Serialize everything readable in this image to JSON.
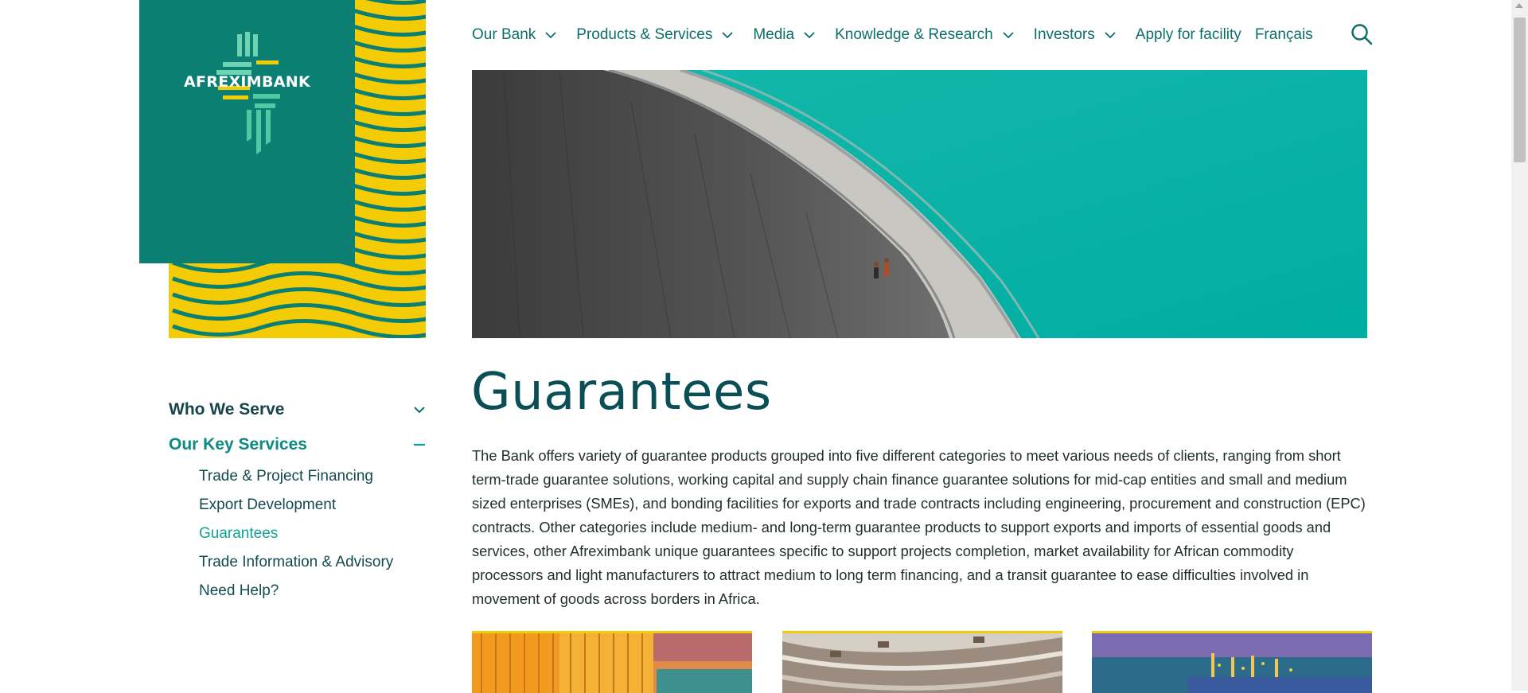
{
  "brand": {
    "logo_text": "AFREXIMBANK",
    "colors": {
      "teal": "#0c7f73",
      "yellow": "#f3cc06",
      "nav_text": "#0c6e68",
      "accent": "#0ea393"
    }
  },
  "nav": {
    "items": [
      {
        "label": "Our Bank",
        "has_dropdown": true
      },
      {
        "label": "Products & Services",
        "has_dropdown": true
      },
      {
        "label": "Media",
        "has_dropdown": true
      },
      {
        "label": "Knowledge & Research",
        "has_dropdown": true
      },
      {
        "label": "Investors",
        "has_dropdown": true
      },
      {
        "label": "Apply for facility",
        "has_dropdown": false
      },
      {
        "label": "Français",
        "has_dropdown": false
      }
    ],
    "search_icon": "search-icon"
  },
  "sidebar": {
    "sections": [
      {
        "label": "Who We Serve",
        "state": "collapsed"
      },
      {
        "label": "Our Key Services",
        "state": "expanded"
      }
    ],
    "items": [
      {
        "label": "Trade & Project Financing"
      },
      {
        "label": "Export Development"
      },
      {
        "label": "Guarantees",
        "active": true
      },
      {
        "label": "Trade Information & Advisory"
      },
      {
        "label": "Need Help?"
      }
    ]
  },
  "main": {
    "title": "Guarantees",
    "intro": "The Bank offers variety of guarantee products grouped into five different categories to meet various needs of clients, ranging from short term-trade guarantee solutions, working capital and supply chain finance guarantee solutions for mid-cap entities and small and medium sized enterprises (SMEs), and bonding facilities for exports and trade contracts including engineering, procurement and construction (EPC) contracts. Other categories include medium- and long-term guarantee products to support exports and imports of essential goods and services, other Afreximbank unique guarantees specific to support projects completion, market availability for African commodity processors and light manufacturers to attract medium to long term financing, and a transit guarantee to ease difficulties involved in movement of goods across borders in Africa."
  }
}
